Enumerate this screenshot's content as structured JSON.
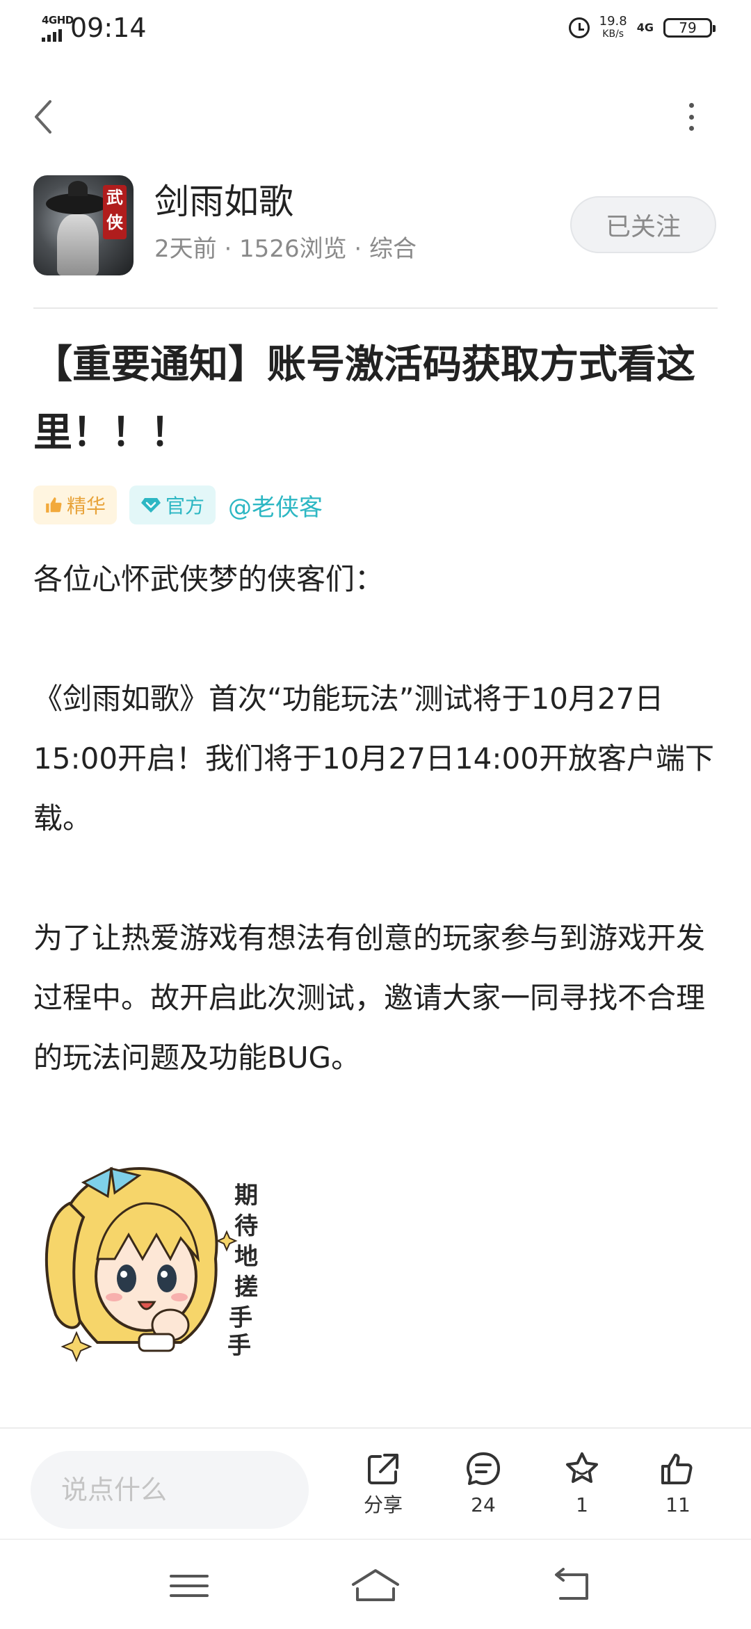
{
  "status_bar": {
    "network_type": "4GHD",
    "time": "09:14",
    "speed_value": "19.8",
    "speed_unit": "KB/s",
    "mobile_data": "4G",
    "battery": "79"
  },
  "author": {
    "avatar_badge": "武侠",
    "name": "剑雨如歌",
    "meta": "2天前 · 1526浏览 · 综合",
    "follow_label": "已关注"
  },
  "post": {
    "title": "【重要通知】账号激活码获取方式看这里！！！",
    "tags": {
      "essence": "精华",
      "official": "官方",
      "mention": "@老侠客"
    },
    "paragraphs": [
      "各位心怀武侠梦的侠客们：",
      "《剑雨如歌》首次“功能玩法”测试将于10月27日15:00开启！我们将于10月27日14:00开放客户端下载。",
      "为了让热爱游戏有想法有创意的玩家参与到游戏开发过程中。故开启此次测试，邀请大家一同寻找不合理的玩法问题及功能BUG。"
    ],
    "sticker_text": "期待地搓手手"
  },
  "action_bar": {
    "comment_placeholder": "说点什么",
    "share_label": "分享",
    "comment_count": "24",
    "favorite_count": "1",
    "like_count": "11"
  },
  "colors": {
    "accent": "#2db7c3",
    "essence": "#e8a33a",
    "muted": "#8a8a8a"
  }
}
